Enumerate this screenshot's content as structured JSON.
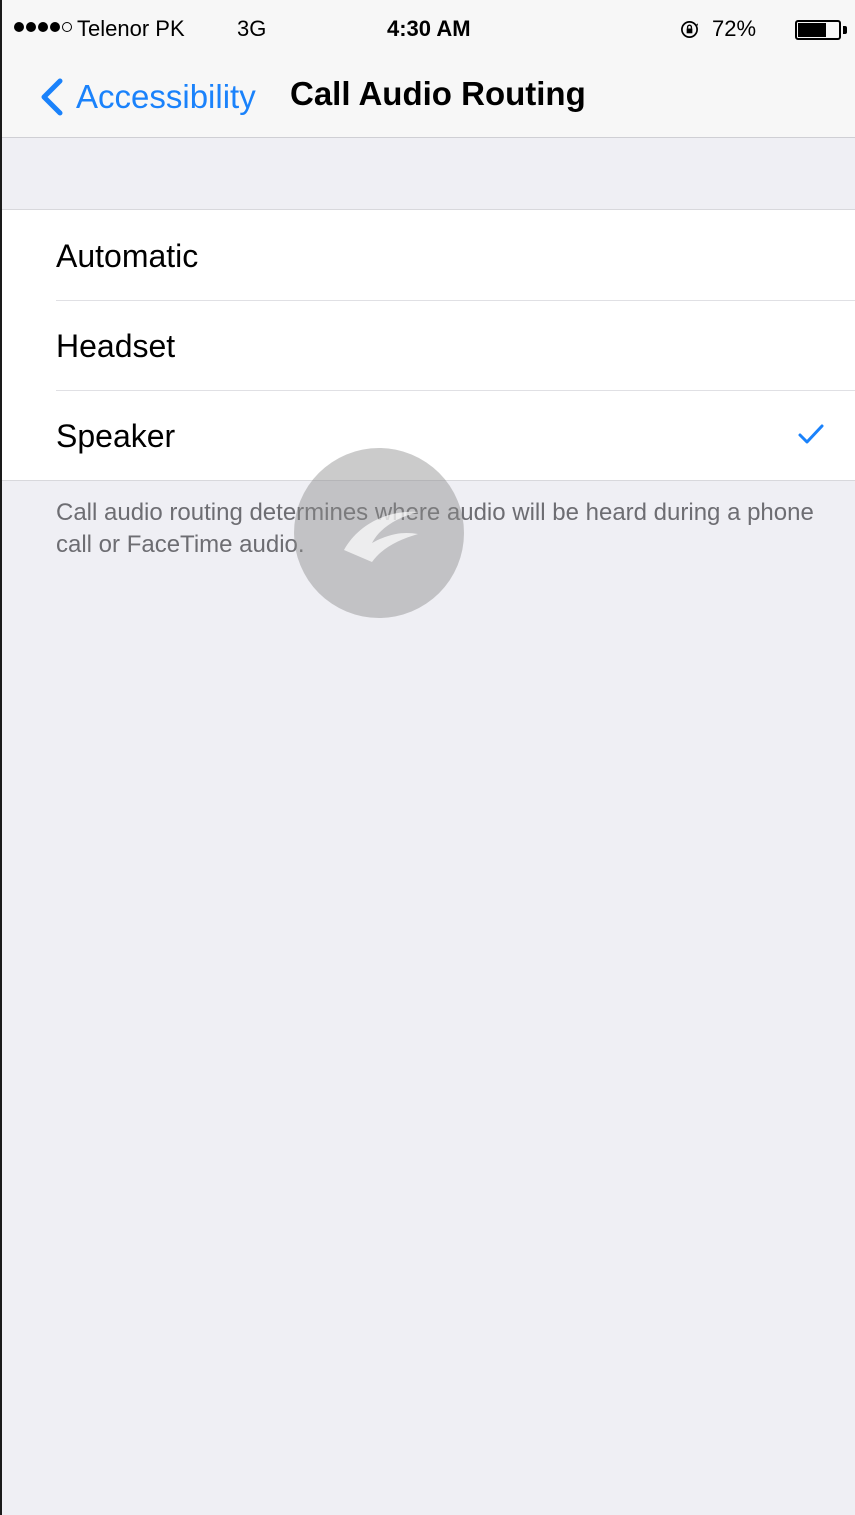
{
  "status_bar": {
    "signal_dots_filled": 4,
    "signal_dots_total": 5,
    "carrier": "Telenor PK",
    "network": "3G",
    "time": "4:30 AM",
    "rotation_lock_icon": "rotation-lock-icon",
    "battery_percent_label": "72%",
    "battery_level": 0.72
  },
  "nav": {
    "back_label": "Accessibility",
    "back_icon": "chevron-left-icon",
    "title": "Call Audio Routing"
  },
  "options": [
    {
      "label": "Automatic",
      "selected": false
    },
    {
      "label": "Headset",
      "selected": false
    },
    {
      "label": "Speaker",
      "selected": true
    }
  ],
  "footer_note": "Call audio routing determines where audio will be heard during a phone call or FaceTime audio.",
  "colors": {
    "accent": "#1a82fb",
    "background": "#efeff4",
    "bar_background": "#f7f7f7",
    "footer_text": "#6d6d72"
  }
}
